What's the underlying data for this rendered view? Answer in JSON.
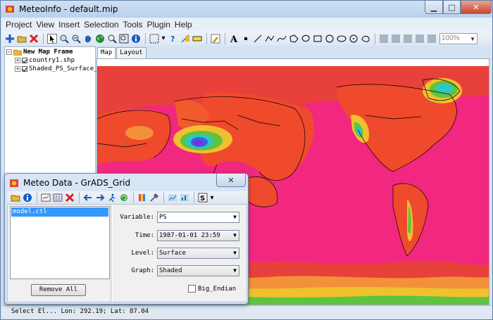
{
  "window": {
    "title": "MeteoInfo - default.mip"
  },
  "menu": [
    "Project",
    "View",
    "Insert",
    "Selection",
    "Tools",
    "Plugin",
    "Help"
  ],
  "toolbar": {
    "zoom_value": "100%",
    "icons": [
      "add-layer-icon",
      "open-folder-icon",
      "remove-icon",
      "select-icon",
      "zoom-in-icon",
      "zoom-out-icon",
      "pan-icon",
      "full-extent-icon",
      "zoom-rect-icon",
      "zoom-layer-icon",
      "identify-icon",
      "select-features-icon",
      "help-icon",
      "measure-icon",
      "label-icon",
      "text-icon",
      "point-icon",
      "line-icon",
      "polyline-icon",
      "curve-icon",
      "polygon-icon",
      "rectangle-icon",
      "circle-icon",
      "ellipse-icon",
      "freehand-icon",
      "layout-1-icon",
      "layout-2-icon",
      "layout-3-icon",
      "layout-4-icon"
    ]
  },
  "legend": {
    "frame": "New Map Frame",
    "layers": [
      "country1.shp",
      "Shaded_PS_Surface_1"
    ]
  },
  "tabs": [
    "Map",
    "Layout"
  ],
  "map": {
    "background_color": "#f2277f"
  },
  "status": {
    "text": "Select El...    Lon: 292.19; Lat: 87.04"
  },
  "dialog": {
    "title": "Meteo Data - GrADS_Grid",
    "files": [
      "model.ctl"
    ],
    "remove_all": "Remove All",
    "variable_label": "Variable:",
    "variable_value": "PS",
    "time_label": "Time:",
    "time_value": "1987-01-01 23:59",
    "level_label": "Level:",
    "level_value": "Surface",
    "graph_label": "Graph:",
    "graph_value": "Shaded",
    "big_endian_label": "Big_Endian"
  }
}
